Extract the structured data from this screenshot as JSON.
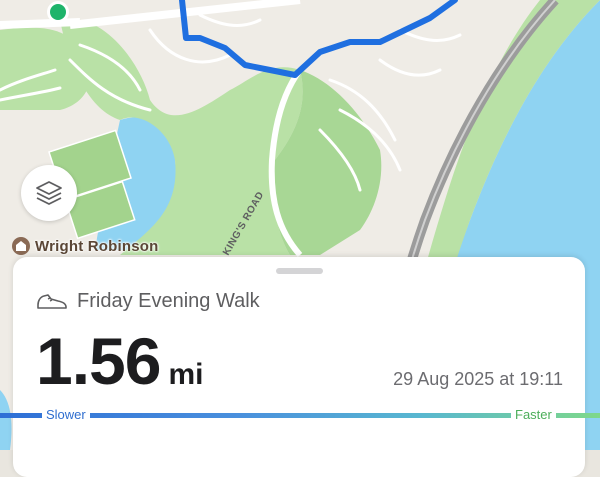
{
  "map": {
    "poi_label": "Wright Robinson",
    "road_label": "KING'S ROAD",
    "colors": {
      "land": "#efece6",
      "park": "#b9e1a6",
      "park_dark": "#a3d38d",
      "water": "#8fd3f2",
      "motorway": "#9c9c9c",
      "route": "#1f6fe0",
      "start_marker": "#1eb46a"
    },
    "layers_button_icon": "layers-icon",
    "poi_icon": "school-icon"
  },
  "activity": {
    "icon": "shoe-icon",
    "title": "Friday Evening Walk",
    "distance_value": "1.56",
    "distance_unit": "mi",
    "datetime": "29 Aug 2025 at 19:11"
  },
  "speed_legend": {
    "slower_label": "Slower",
    "faster_label": "Faster"
  }
}
